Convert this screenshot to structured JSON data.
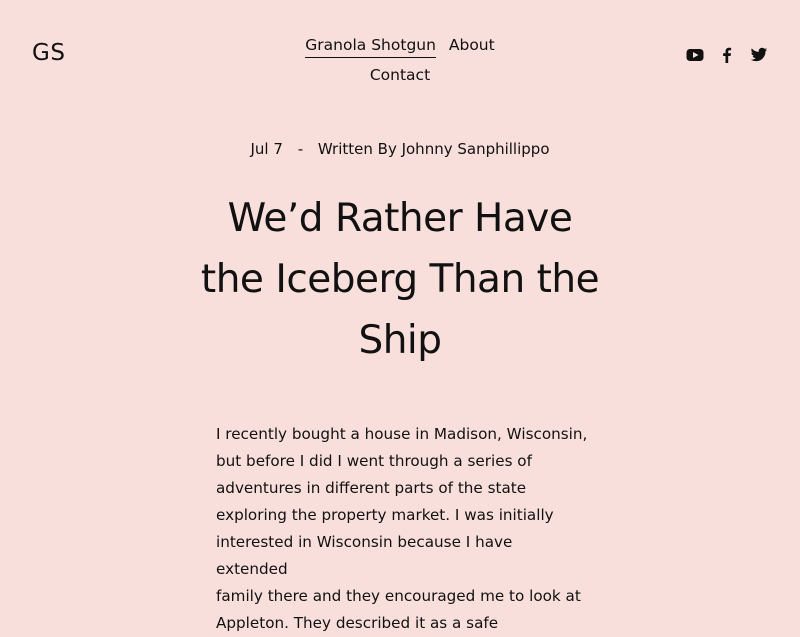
{
  "site": {
    "logo": "GS"
  },
  "nav": {
    "items": [
      {
        "label": "Granola Shotgun",
        "active": true
      },
      {
        "label": "About",
        "active": false
      },
      {
        "label": "Contact",
        "active": false
      }
    ]
  },
  "social": [
    {
      "name": "youtube-icon"
    },
    {
      "name": "facebook-icon"
    },
    {
      "name": "twitter-icon"
    }
  ],
  "article": {
    "date": "Jul 7",
    "separator": "-",
    "byline": "Written By Johnny Sanphillippo",
    "title": "We’d Rather Have the Iceberg Than the Ship",
    "body_lines": [
      "I recently bought a house in Madison, Wisconsin,",
      "but before I did I went through a series of",
      "adventures in different parts of the state",
      "exploring the property market. I was initially",
      "interested in Wisconsin because I have extended",
      "family there and they encouraged me to look at",
      "Appleton. They described it as a safe"
    ]
  },
  "colors": {
    "background": "#f8dfdc",
    "text": "#111111"
  }
}
